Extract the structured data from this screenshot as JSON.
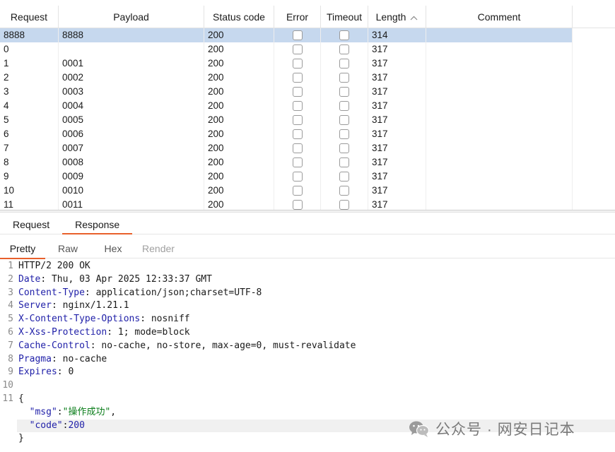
{
  "table": {
    "columns": [
      "Request",
      "Payload",
      "Status code",
      "Error",
      "Timeout",
      "Length",
      "Comment"
    ],
    "sort_indicator": "^",
    "rows": [
      {
        "request": "8888",
        "payload": "8888",
        "status": "200",
        "length": "314",
        "selected": true
      },
      {
        "request": "0",
        "payload": "",
        "status": "200",
        "length": "317"
      },
      {
        "request": "1",
        "payload": "0001",
        "status": "200",
        "length": "317"
      },
      {
        "request": "2",
        "payload": "0002",
        "status": "200",
        "length": "317"
      },
      {
        "request": "3",
        "payload": "0003",
        "status": "200",
        "length": "317"
      },
      {
        "request": "4",
        "payload": "0004",
        "status": "200",
        "length": "317"
      },
      {
        "request": "5",
        "payload": "0005",
        "status": "200",
        "length": "317"
      },
      {
        "request": "6",
        "payload": "0006",
        "status": "200",
        "length": "317"
      },
      {
        "request": "7",
        "payload": "0007",
        "status": "200",
        "length": "317"
      },
      {
        "request": "8",
        "payload": "0008",
        "status": "200",
        "length": "317"
      },
      {
        "request": "9",
        "payload": "0009",
        "status": "200",
        "length": "317"
      },
      {
        "request": "10",
        "payload": "0010",
        "status": "200",
        "length": "317"
      },
      {
        "request": "11",
        "payload": "0011",
        "status": "200",
        "length": "317"
      }
    ]
  },
  "message_tabs": {
    "request": "Request",
    "response": "Response",
    "active": "Response"
  },
  "view_tabs": {
    "pretty": "Pretty",
    "raw": "Raw",
    "hex": "Hex",
    "render": "Render",
    "active": "Pretty"
  },
  "response": {
    "status_line": "HTTP/2 200 OK",
    "headers": [
      {
        "name": "Date",
        "value": "Thu, 03 Apr 2025 12:33:37 GMT"
      },
      {
        "name": "Content-Type",
        "value": "application/json;charset=UTF-8"
      },
      {
        "name": "Server",
        "value": "nginx/1.21.1"
      },
      {
        "name": "X-Content-Type-Options",
        "value": "nosniff"
      },
      {
        "name": "X-Xss-Protection",
        "value": "1; mode=block"
      },
      {
        "name": "Cache-Control",
        "value": "no-cache, no-store, max-age=0, must-revalidate"
      },
      {
        "name": "Pragma",
        "value": "no-cache"
      },
      {
        "name": "Expires",
        "value": "0"
      }
    ],
    "body_open": "{",
    "body_fields": [
      {
        "key": "\"msg\"",
        "value": "\"操作成功\"",
        "type": "string",
        "trailing": ","
      },
      {
        "key": "\"code\"",
        "value": "200",
        "type": "number",
        "trailing": ""
      }
    ],
    "body_close": "}",
    "line_numbers": [
      "1",
      "2",
      "3",
      "4",
      "5",
      "6",
      "7",
      "8",
      "9",
      "10",
      "11"
    ]
  },
  "watermark": {
    "text": "公众号 · 网安日记本"
  },
  "colors": {
    "accent": "#e8602c",
    "selection": "#c6d8ee",
    "header_name": "#1f1fa8",
    "json_string": "#0a7d1a"
  }
}
